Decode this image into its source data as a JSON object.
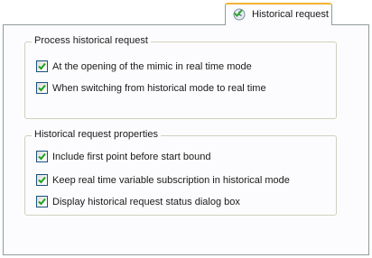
{
  "tab": {
    "label": "Historical request",
    "icon": "history-icon"
  },
  "process_group": {
    "legend": "Process historical request",
    "items": [
      {
        "label": "At the opening of the mimic in real time mode",
        "checked": true
      },
      {
        "label": "When switching from historical mode to real time",
        "checked": true
      }
    ]
  },
  "properties_group": {
    "legend": "Historical request properties",
    "items": [
      {
        "label": "Include first point before start bound",
        "checked": true
      },
      {
        "label": "Keep real time variable subscription in historical mode",
        "checked": true
      },
      {
        "label": "Display historical request status dialog box",
        "checked": true
      }
    ]
  },
  "colors": {
    "checkbox_border": "#1c5180",
    "checkmark": "#21a121",
    "tab_highlight": "#f5b434",
    "panel_border": "#919b9c",
    "group_border": "#d0d0bf"
  }
}
